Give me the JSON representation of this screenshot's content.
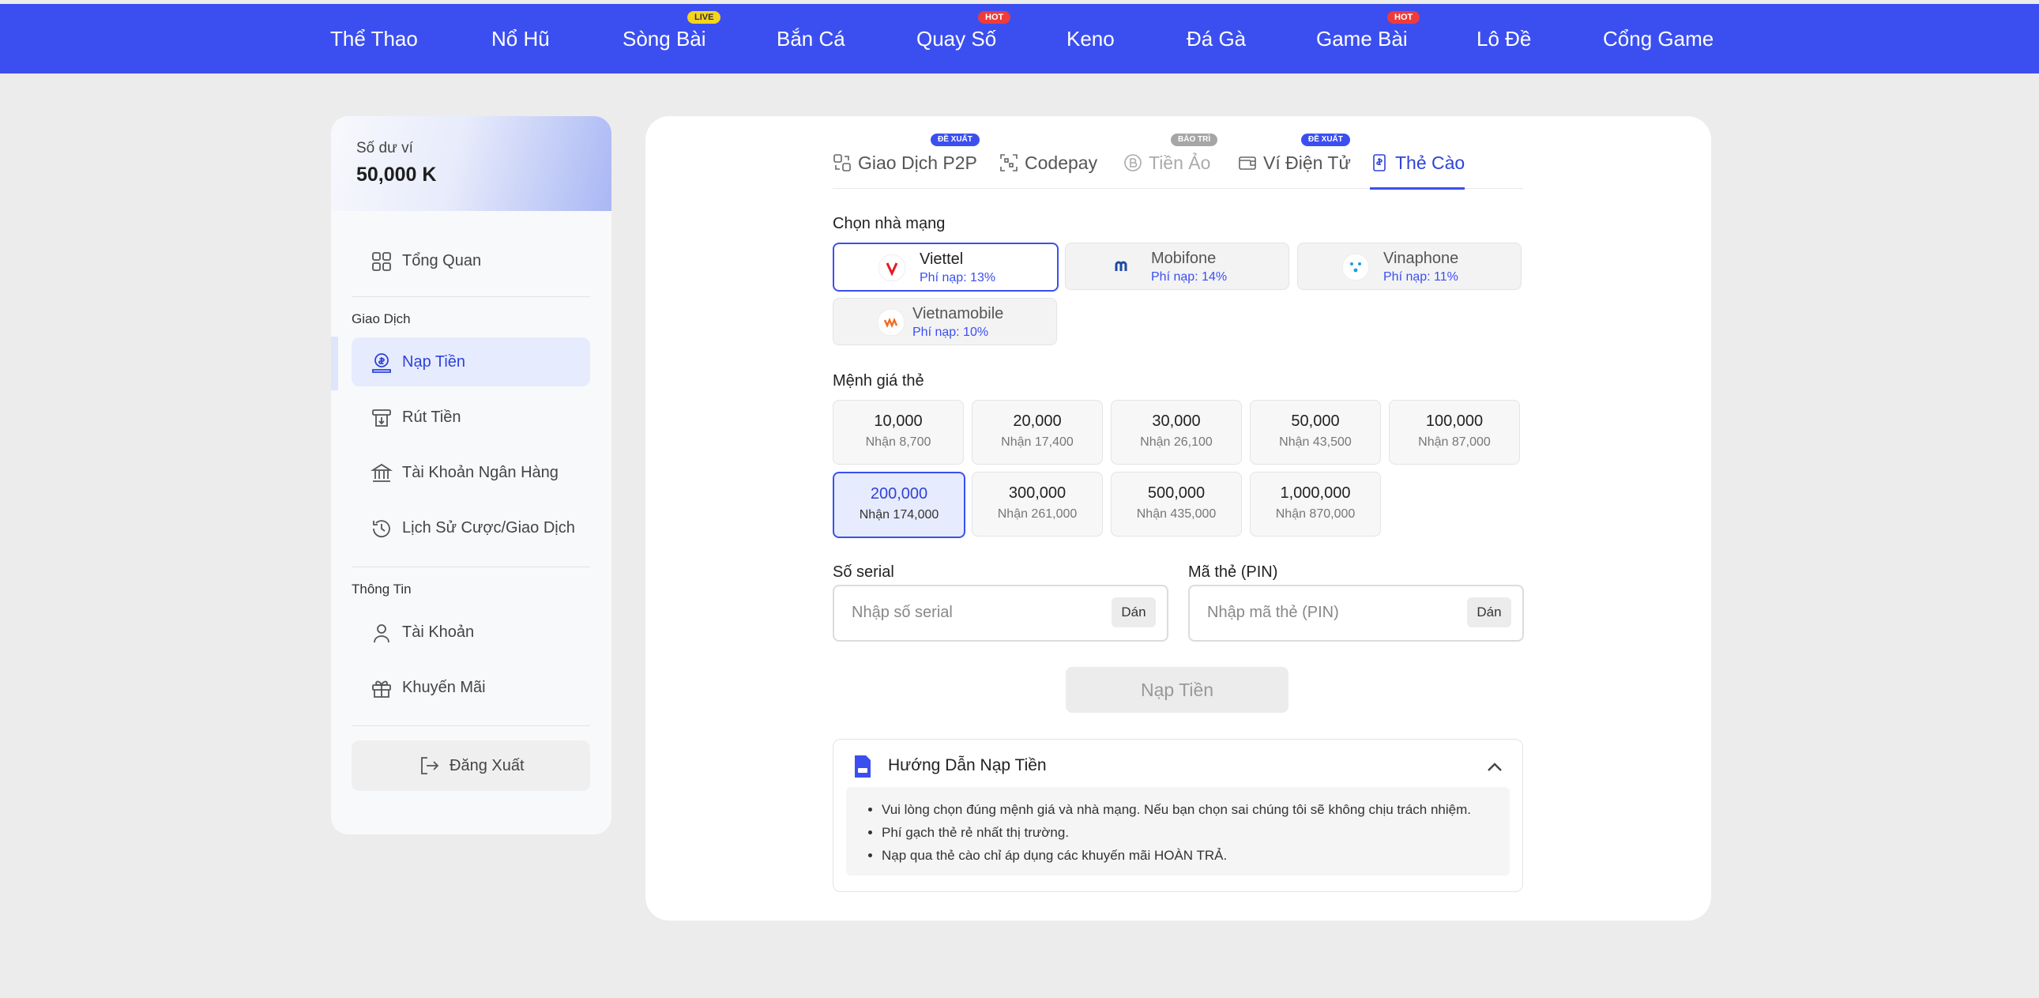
{
  "nav": {
    "items": [
      {
        "label": "Thể Thao"
      },
      {
        "label": "Nổ Hũ"
      },
      {
        "label": "Sòng Bài",
        "badge": "LIVE"
      },
      {
        "label": "Bắn Cá"
      },
      {
        "label": "Quay Số",
        "badge": "HOT"
      },
      {
        "label": "Keno"
      },
      {
        "label": "Đá Gà"
      },
      {
        "label": "Game Bài",
        "badge": "HOT"
      },
      {
        "label": "Lô Đề"
      },
      {
        "label": "Cổng Game"
      }
    ]
  },
  "wallet": {
    "label": "Số dư ví",
    "balance": "50,000 K"
  },
  "sidebar": {
    "overview": "Tổng Quan",
    "section_transactions": "Giao Dịch",
    "deposit": "Nạp Tiền",
    "withdraw": "Rút Tiền",
    "bank_account": "Tài Khoản Ngân Hàng",
    "history": "Lịch Sử Cược/Giao Dịch",
    "section_info": "Thông Tin",
    "account": "Tài Khoản",
    "promotions": "Khuyến Mãi",
    "logout": "Đăng Xuất"
  },
  "tabs": [
    {
      "label": "Giao Dịch P2P",
      "badge": "ĐỀ XUẤT"
    },
    {
      "label": "Codepay"
    },
    {
      "label": "Tiền Ảo",
      "badge": "BẢO TRÌ"
    },
    {
      "label": "Ví Điện Tử",
      "badge": "ĐỀ XUẤT"
    },
    {
      "label": "Thẻ Cào",
      "active": true
    }
  ],
  "carrier_section": {
    "label": "Chọn nhà mạng",
    "carriers": [
      {
        "name": "Viettel",
        "fee": "Phí nạp: 13%",
        "selected": true
      },
      {
        "name": "Mobifone",
        "fee": "Phí nạp: 14%"
      },
      {
        "name": "Vinaphone",
        "fee": "Phí nạp: 11%"
      },
      {
        "name": "Vietnamobile",
        "fee": "Phí nạp: 10%"
      }
    ]
  },
  "denom_section": {
    "label": "Mệnh giá thẻ",
    "denoms": [
      {
        "value": "10,000",
        "receive": "Nhận 8,700"
      },
      {
        "value": "20,000",
        "receive": "Nhận 17,400"
      },
      {
        "value": "30,000",
        "receive": "Nhận 26,100"
      },
      {
        "value": "50,000",
        "receive": "Nhận 43,500"
      },
      {
        "value": "100,000",
        "receive": "Nhận 87,000"
      },
      {
        "value": "200,000",
        "receive": "Nhận 174,000",
        "selected": true
      },
      {
        "value": "300,000",
        "receive": "Nhận 261,000"
      },
      {
        "value": "500,000",
        "receive": "Nhận 435,000"
      },
      {
        "value": "1,000,000",
        "receive": "Nhận 870,000"
      }
    ]
  },
  "serial": {
    "label": "Số serial",
    "placeholder": "Nhập số serial",
    "value": "",
    "paste": "Dán"
  },
  "pin": {
    "label": "Mã thẻ (PIN)",
    "placeholder": "Nhập mã thẻ (PIN)",
    "value": "",
    "paste": "Dán"
  },
  "submit_label": "Nạp Tiền",
  "guide": {
    "title": "Hướng Dẫn Nạp Tiền",
    "items": [
      "Vui lòng chọn đúng mệnh giá và nhà mạng. Nếu bạn chọn sai chúng tôi sẽ không chịu trách nhiệm.",
      "Phí gạch thẻ rẻ nhất thị trường.",
      "Nạp qua thẻ cào chỉ áp dụng các khuyến mãi HOÀN TRẢ."
    ]
  },
  "colors": {
    "brand": "#3b4ff0",
    "hot": "#ef3b3b",
    "live": "#f5d41f"
  }
}
